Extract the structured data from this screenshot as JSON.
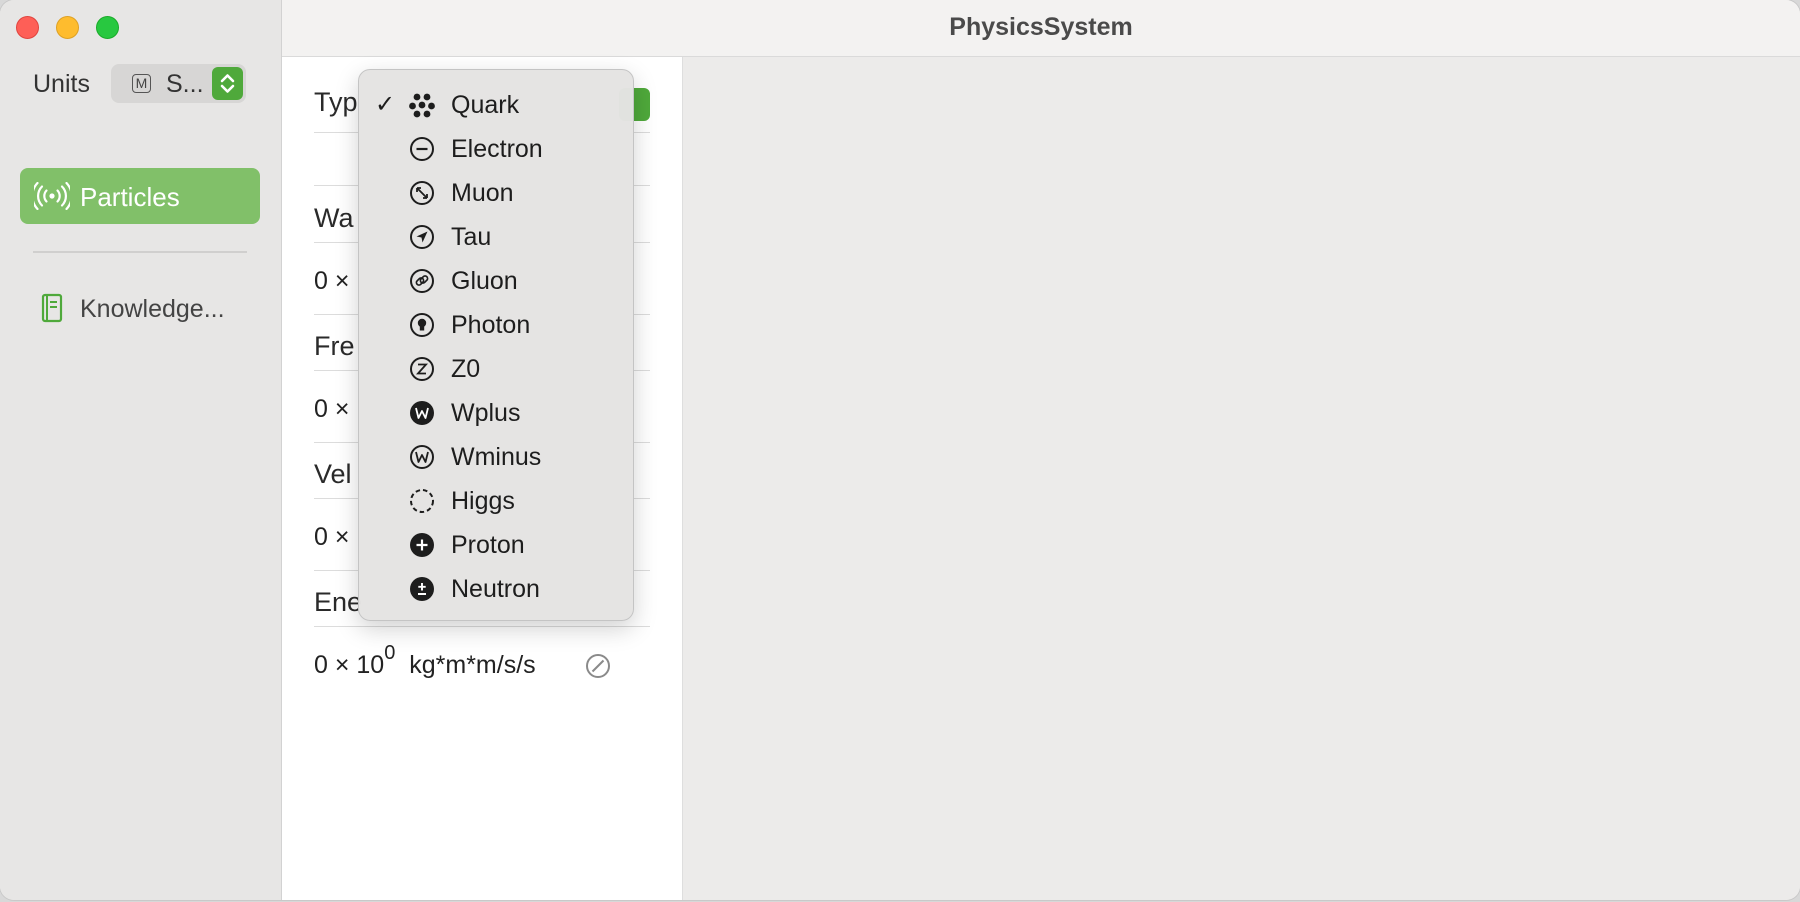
{
  "window": {
    "title": "PhysicsSystem"
  },
  "sidebar": {
    "units_label": "Units",
    "units_badge": "M",
    "units_value": "S...",
    "items": [
      {
        "label": "Particles",
        "icon": "broadcast-icon",
        "selected": true
      },
      {
        "label": "Knowledge...",
        "icon": "book-icon",
        "selected": false
      }
    ]
  },
  "form": {
    "type_label": "Typ",
    "rows": [
      {
        "label": "Wa",
        "value": "0 ×"
      },
      {
        "label": "Fre",
        "value": "0 ×"
      },
      {
        "label": "Vel",
        "value": "0 ×"
      },
      {
        "label": "Ene",
        "value": "0 × 10",
        "exponent": "0",
        "unit": "kg*m*m/s/s"
      }
    ]
  },
  "menu": {
    "selected": "Quark",
    "items": [
      {
        "label": "Quark",
        "icon": "dots-icon"
      },
      {
        "label": "Electron",
        "icon": "minus-circle-icon"
      },
      {
        "label": "Muon",
        "icon": "arrows-diagonal-circle-icon"
      },
      {
        "label": "Tau",
        "icon": "location-arrow-circle-icon"
      },
      {
        "label": "Gluon",
        "icon": "link-circle-icon"
      },
      {
        "label": "Photon",
        "icon": "lightbulb-circle-icon"
      },
      {
        "label": "Z0",
        "icon": "z-circle-icon"
      },
      {
        "label": "Wplus",
        "icon": "w-filled-circle-icon"
      },
      {
        "label": "Wminus",
        "icon": "w-circle-icon"
      },
      {
        "label": "Higgs",
        "icon": "dashed-circle-icon"
      },
      {
        "label": "Proton",
        "icon": "plus-filled-circle-icon"
      },
      {
        "label": "Neutron",
        "icon": "plusminus-filled-circle-icon"
      }
    ]
  },
  "colors": {
    "accent": "#4fa93b",
    "selection": "#81c069"
  }
}
